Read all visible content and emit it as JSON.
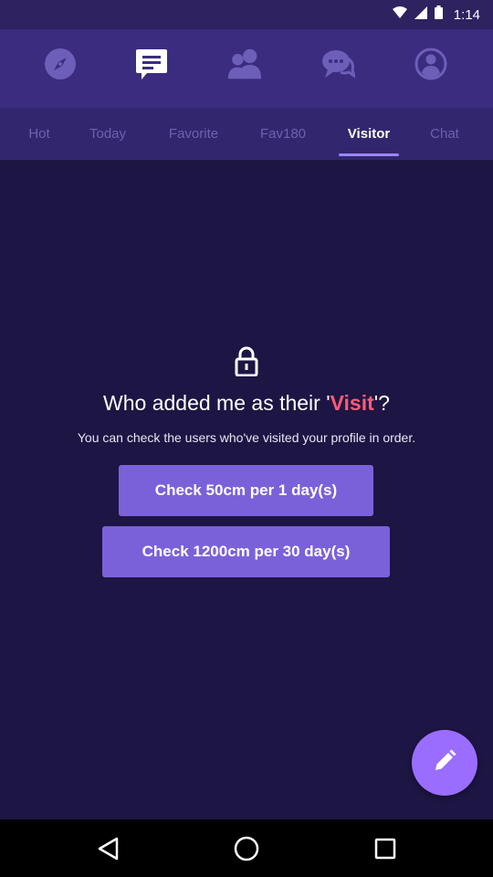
{
  "status_bar": {
    "time": "1:14"
  },
  "top_icons": [
    "compass-icon",
    "feed-icon",
    "people-icon",
    "chat-bubbles-icon",
    "profile-icon"
  ],
  "tabs": [
    {
      "label": "Hot",
      "active": false
    },
    {
      "label": "Today",
      "active": false
    },
    {
      "label": "Favorite",
      "active": false
    },
    {
      "label": "Fav180",
      "active": false
    },
    {
      "label": "Visitor",
      "active": true
    },
    {
      "label": "Chat",
      "active": false
    }
  ],
  "visitor": {
    "title_prefix": "Who added me as their '",
    "title_accent": "Visit",
    "title_suffix": "'?",
    "subtitle": "You can check the users who've visited your profile in order.",
    "button_1": "Check 50cm per 1 day(s)",
    "button_2": "Check 1200cm per 30 day(s)"
  },
  "colors": {
    "accent": "#ff5c74",
    "button": "#7b61d9",
    "fab": "#9a6dff",
    "background": "#1d1543",
    "header": "#3b2c80"
  }
}
